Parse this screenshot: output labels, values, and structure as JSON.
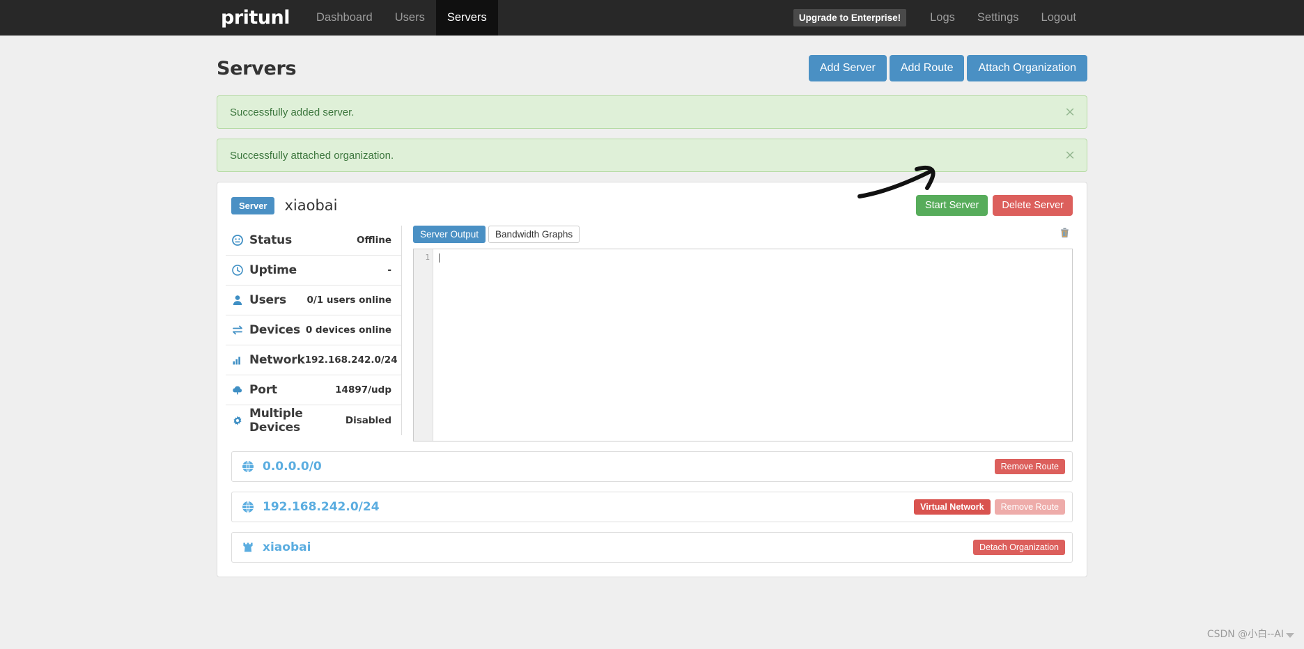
{
  "navbar": {
    "brand": "pritunl",
    "links": [
      {
        "label": "Dashboard",
        "active": false
      },
      {
        "label": "Users",
        "active": false
      },
      {
        "label": "Servers",
        "active": true
      }
    ],
    "upgrade_label": "Upgrade to Enterprise!",
    "right_links": [
      {
        "label": "Logs"
      },
      {
        "label": "Settings"
      },
      {
        "label": "Logout"
      }
    ]
  },
  "header": {
    "title": "Servers",
    "buttons": [
      {
        "label": "Add Server"
      },
      {
        "label": "Add Route"
      },
      {
        "label": "Attach Organization"
      }
    ]
  },
  "alerts": [
    {
      "message": "Successfully added server.",
      "close": "×"
    },
    {
      "message": "Successfully attached organization.",
      "close": "×"
    }
  ],
  "server": {
    "badge": "Server",
    "name": "xiaobai",
    "start_label": "Start Server",
    "delete_label": "Delete Server",
    "status": [
      {
        "icon": "status-icon",
        "name": "Status",
        "value": "Offline"
      },
      {
        "icon": "clock-icon",
        "name": "Uptime",
        "value": "-"
      },
      {
        "icon": "user-icon",
        "name": "Users",
        "value": "0/1 users online"
      },
      {
        "icon": "exchange-icon",
        "name": "Devices",
        "value": "0 devices online"
      },
      {
        "icon": "signal-icon",
        "name": "Network",
        "value": "192.168.242.0/24"
      },
      {
        "icon": "cloud-upload-icon",
        "name": "Port",
        "value": "14897/udp"
      },
      {
        "icon": "gear-icon",
        "name": "Multiple Devices",
        "value": "Disabled"
      }
    ],
    "tabs": [
      {
        "label": "Server Output",
        "active": true
      },
      {
        "label": "Bandwidth Graphs",
        "active": false
      }
    ],
    "console": {
      "line_number": "1",
      "text": ""
    },
    "clear_icon": "trash-icon"
  },
  "routes": [
    {
      "icon": "globe-icon",
      "network": "0.0.0.0/0",
      "virtual_network_label": null,
      "remove_label": "Remove Route"
    },
    {
      "icon": "globe-icon",
      "network": "192.168.242.0/24",
      "virtual_network_label": "Virtual Network",
      "remove_label": "Remove Route"
    }
  ],
  "organizations": [
    {
      "icon": "organization-icon",
      "name": "xiaobai",
      "detach_label": "Detach Organization"
    }
  ],
  "watermark": {
    "text": "CSDN @小白--AI"
  },
  "colors": {
    "navbar_bg": "#282828",
    "navbar_active_bg": "#101010",
    "primary": "#4a90c4",
    "success": "#57ac5b",
    "danger": "#dc5f5c",
    "alert_bg": "#dff0d8",
    "alert_border": "#b6dba4",
    "alert_text": "#3c763d",
    "link_blue": "#5bade0",
    "page_bg": "#efefef"
  }
}
